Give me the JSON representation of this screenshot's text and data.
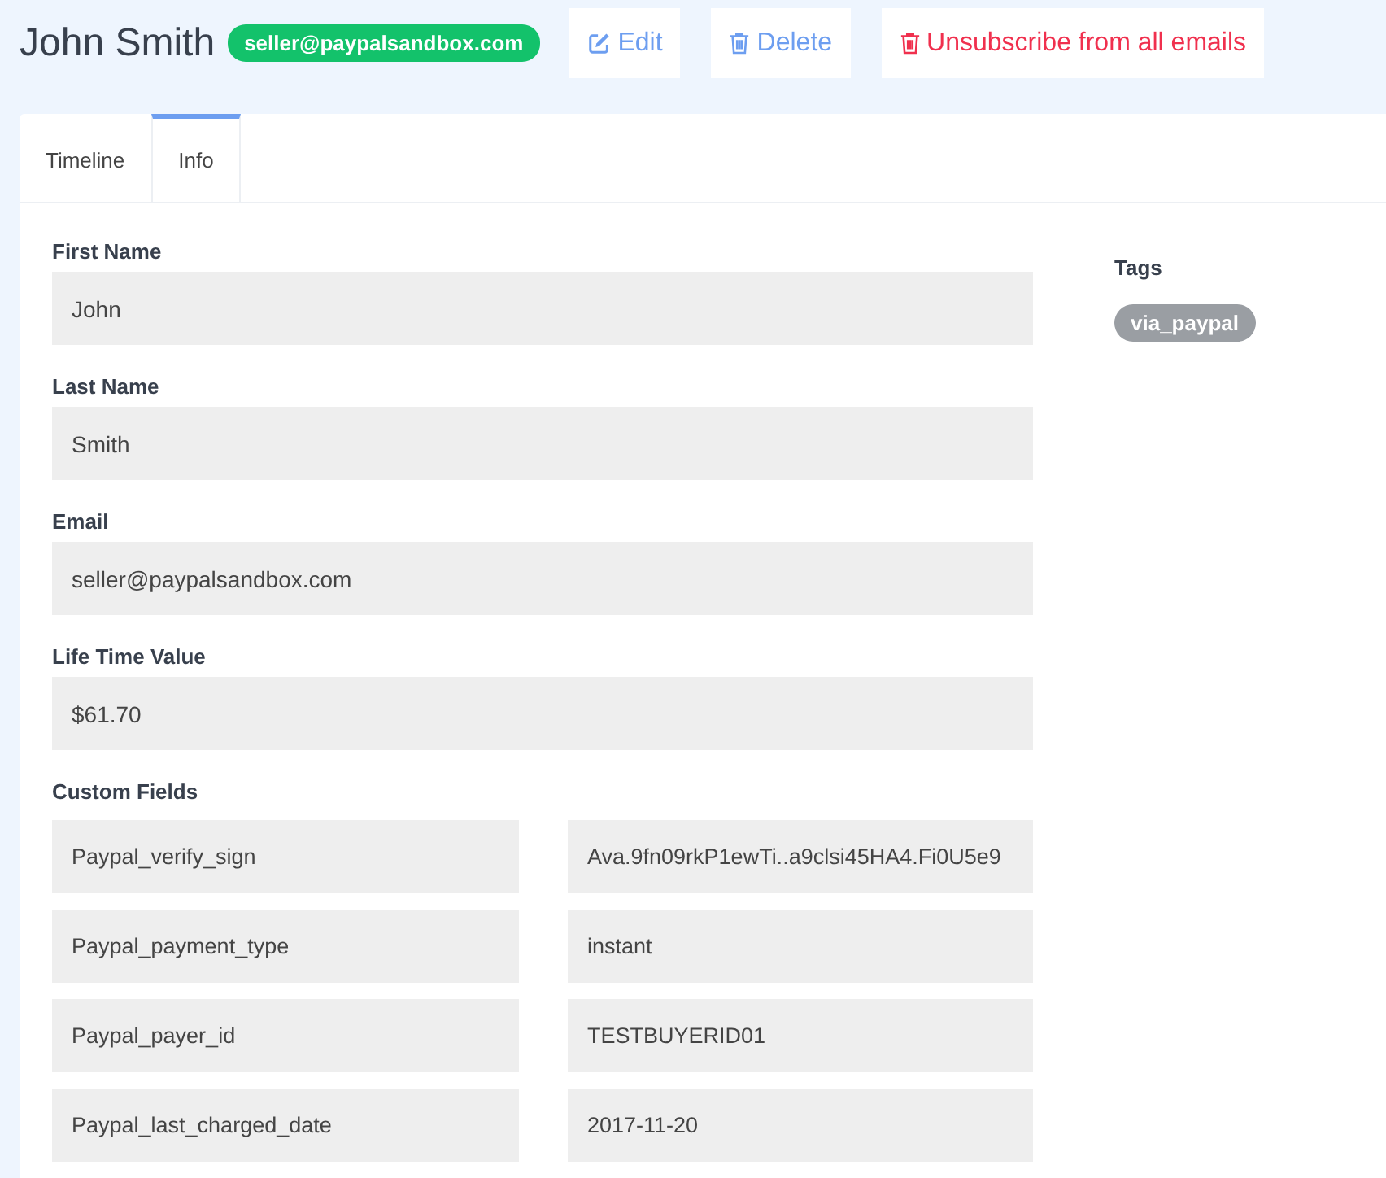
{
  "contact": {
    "name": "John Smith",
    "email_badge": "seller@paypalsandbox.com"
  },
  "actions": [
    {
      "label": "Edit",
      "kind": "edit"
    },
    {
      "label": "Delete",
      "kind": "delete"
    },
    {
      "label": "Unsubscribe from all emails",
      "kind": "unsubscribe"
    }
  ],
  "tabs": [
    {
      "label": "Timeline",
      "selected": false
    },
    {
      "label": "Info",
      "selected": true
    }
  ],
  "fields": [
    {
      "label": "First Name",
      "value": "John"
    },
    {
      "label": "Last Name",
      "value": "Smith"
    },
    {
      "label": "Email",
      "value": "seller@paypalsandbox.com"
    },
    {
      "label": "Life Time Value",
      "value": "$61.70"
    }
  ],
  "custom_fields": {
    "label": "Custom Fields",
    "rows": [
      {
        "key": "Paypal_verify_sign",
        "value": "Ava.9fn09rkP1ewTi..a9clsi45HA4.Fi0U5e9"
      },
      {
        "key": "Paypal_payment_type",
        "value": "instant"
      },
      {
        "key": "Paypal_payer_id",
        "value": "TESTBUYERID01"
      },
      {
        "key": "Paypal_last_charged_date",
        "value": "2017-11-20"
      }
    ]
  },
  "tags": {
    "label": "Tags",
    "items": [
      "via_paypal"
    ]
  }
}
